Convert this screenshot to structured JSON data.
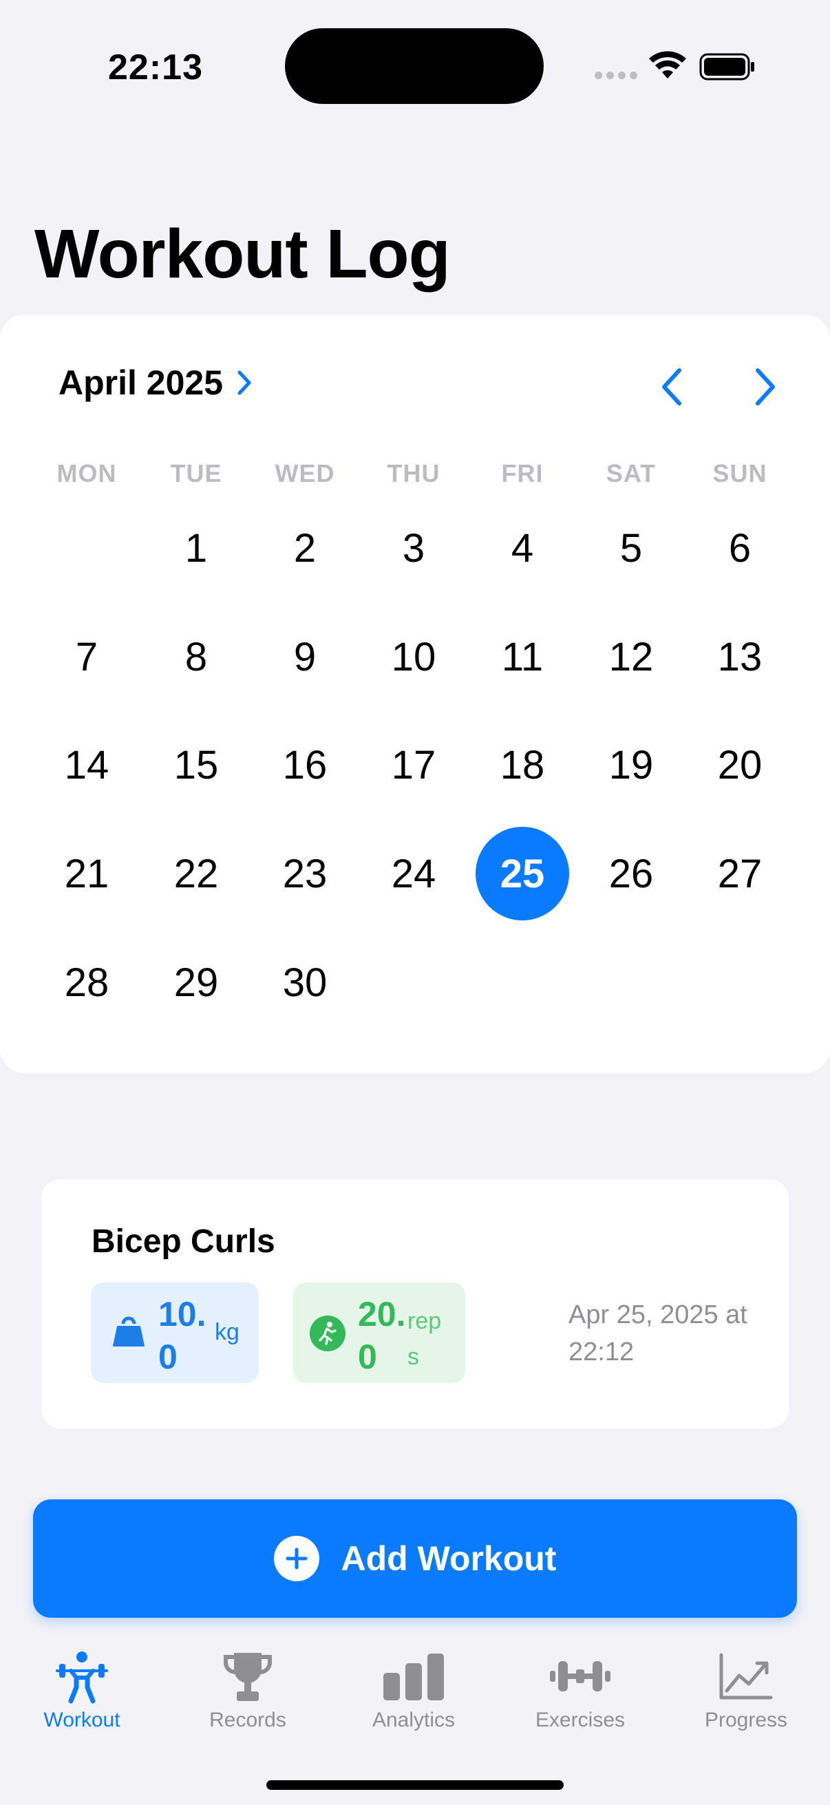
{
  "status_bar": {
    "time": "22:13"
  },
  "header": {
    "title": "Workout Log"
  },
  "calendar": {
    "month_label": "April 2025",
    "weekdays": [
      "MON",
      "TUE",
      "WED",
      "THU",
      "FRI",
      "SAT",
      "SUN"
    ],
    "days": [
      "1",
      "2",
      "3",
      "4",
      "5",
      "6",
      "7",
      "8",
      "9",
      "10",
      "11",
      "12",
      "13",
      "14",
      "15",
      "16",
      "17",
      "18",
      "19",
      "20",
      "21",
      "22",
      "23",
      "24",
      "25",
      "26",
      "27",
      "28",
      "29",
      "30"
    ],
    "first_weekday_index": 1,
    "selected_day": "25",
    "accent_color": "#0a7bff"
  },
  "workout_entry": {
    "exercise": "Bicep Curls",
    "weight_value": "10.0",
    "weight_unit": "kg",
    "reps_value": "20.0",
    "reps_unit": "reps",
    "date": "Apr 25, 2025 at 22:12"
  },
  "add_button": {
    "label": "Add Workout"
  },
  "tab_bar": {
    "tabs": [
      {
        "label": "Workout",
        "icon": "weightlifter-icon",
        "active": true
      },
      {
        "label": "Records",
        "icon": "trophy-icon",
        "active": false
      },
      {
        "label": "Analytics",
        "icon": "bar-chart-icon",
        "active": false
      },
      {
        "label": "Exercises",
        "icon": "dumbbell-icon",
        "active": false
      },
      {
        "label": "Progress",
        "icon": "line-chart-icon",
        "active": false
      }
    ]
  }
}
